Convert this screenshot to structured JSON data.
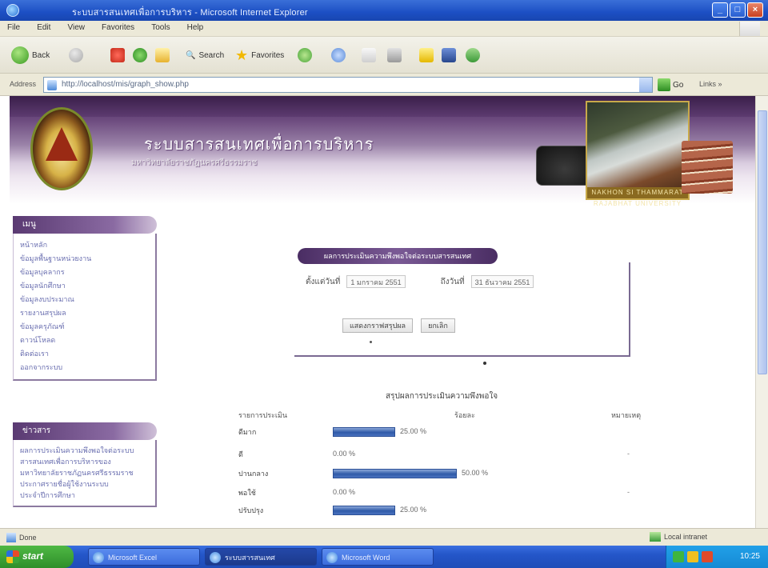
{
  "window": {
    "title": "ระบบสารสนเทศเพื่อการบริหาร - Microsoft Internet Explorer",
    "controls": {
      "minimize": "_",
      "maximize": "□",
      "close": "×"
    }
  },
  "menu": [
    "File",
    "Edit",
    "View",
    "Favorites",
    "Tools",
    "Help"
  ],
  "toolbar": {
    "back": "Back",
    "search": "Search",
    "favorites": "Favorites"
  },
  "address": {
    "label": "Address",
    "url": "http://localhost/mis/graph_show.php",
    "go": "Go",
    "links": "Links »"
  },
  "banner": {
    "title": "ระบบสารสนเทศเพื่อการบริหาร",
    "subtitle": "มหาวิทยาลัยราชภัฏนครศรีธรรมราช",
    "photo_caption": "NAKHON SI THAMMARAT RAJABHAT UNIVERSITY"
  },
  "sidebar_menu": {
    "header": "เมนู",
    "items": [
      "หน้าหลัก",
      "ข้อมูลพื้นฐานหน่วยงาน",
      "ข้อมูลบุคลากร",
      "ข้อมูลนักศึกษา",
      "ข้อมูลงบประมาณ",
      "รายงานสรุปผล",
      "ข้อมูลครุภัณฑ์",
      "ดาวน์โหลด",
      "ติดต่อเรา",
      "ออกจากระบบ"
    ]
  },
  "sidebar_news": {
    "header": "ข่าวสาร",
    "items": [
      "ผลการประเมินความพึงพอใจต่อระบบ",
      "สารสนเทศเพื่อการบริหารของ",
      "มหาวิทยาลัยราชภัฏนครศรีธรรมราช",
      "ประกาศรายชื่อผู้ใช้งานระบบ",
      "ประจำปีการศึกษา"
    ]
  },
  "form": {
    "header": "ผลการประเมินความพึงพอใจต่อระบบสารสนเทศ",
    "label_from": "ตั้งแต่วันที่",
    "from_value": "1 มกราคม 2551",
    "label_to": "ถึงวันที่",
    "to_value": "31 ธันวาคม 2551",
    "btn_show": "แสดงกราฟสรุปผล",
    "btn_cancel": "ยกเลิก"
  },
  "results": {
    "title": "สรุปผลการประเมินความพึงพอใจ",
    "col_item": "รายการประเมิน",
    "col_graph": "ร้อยละ",
    "col_note": "หมายเหตุ",
    "rows": [
      {
        "label": "ดีมาก",
        "percent": 25.0,
        "pct_text": "25.00 %",
        "mark": ""
      },
      {
        "label": "ดี",
        "percent": 0.0,
        "pct_text": "0.00 %",
        "mark": "-"
      },
      {
        "label": "ปานกลาง",
        "percent": 50.0,
        "pct_text": "50.00 %",
        "mark": ""
      },
      {
        "label": "พอใช้",
        "percent": 0.0,
        "pct_text": "0.00 %",
        "mark": "-"
      },
      {
        "label": "ปรับปรุง",
        "percent": 25.0,
        "pct_text": "25.00 %",
        "mark": ""
      }
    ]
  },
  "status": {
    "left": "Done",
    "zone": "Local intranet"
  },
  "taskbar": {
    "start": "start",
    "tasks": [
      "Microsoft Excel",
      "ระบบสารสนเทศ",
      "Microsoft Word"
    ],
    "clock": "10:25"
  }
}
